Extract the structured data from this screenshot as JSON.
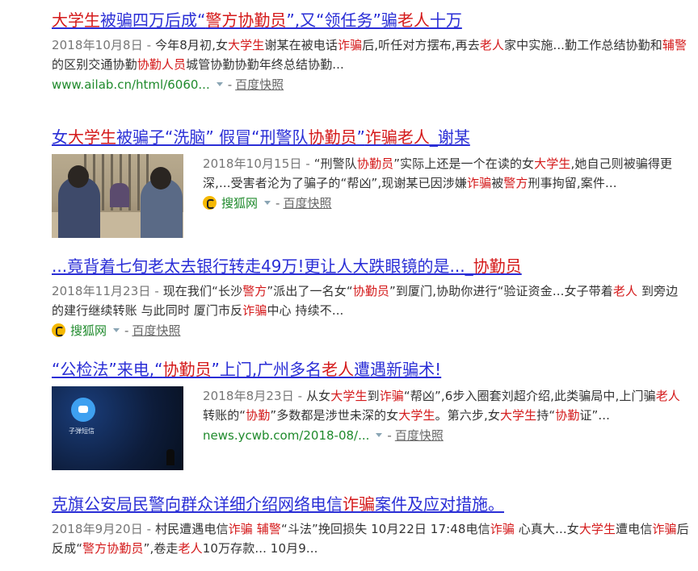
{
  "results": [
    {
      "title": [
        {
          "t": "大学生",
          "h": true
        },
        {
          "t": "被骗四万后成“",
          "h": false
        },
        {
          "t": "警方协勤员",
          "h": true
        },
        {
          "t": "”,又“领任务”骗",
          "h": false
        },
        {
          "t": "老人",
          "h": true
        },
        {
          "t": "十万",
          "h": false
        }
      ],
      "abstract": [
        {
          "t": "2018年10月8日 - ",
          "c": "date"
        },
        {
          "t": "今年8月初,女",
          "c": ""
        },
        {
          "t": "大学生",
          "c": "hl"
        },
        {
          "t": "谢某在被电话",
          "c": ""
        },
        {
          "t": "诈骗",
          "c": "hl"
        },
        {
          "t": "后,听任对方摆布,再去",
          "c": ""
        },
        {
          "t": "老人",
          "c": "hl"
        },
        {
          "t": "家中实施...勤工作总结协勤和",
          "c": ""
        },
        {
          "t": "辅警",
          "c": "hl"
        },
        {
          "t": "的区别交通协勤",
          "c": ""
        },
        {
          "t": "协勤人员",
          "c": "hl"
        },
        {
          "t": "城管协勤协勤年终总结协勤...",
          "c": ""
        }
      ],
      "source": {
        "url": "www.ailab.cn/html/6060...",
        "cache": "百度快照"
      }
    },
    {
      "title": [
        {
          "t": "女",
          "h": false
        },
        {
          "t": "大学生",
          "h": true
        },
        {
          "t": "被骗子“洗脑” 假冒“刑警队",
          "h": false
        },
        {
          "t": "协勤员",
          "h": true
        },
        {
          "t": "”",
          "h": false
        },
        {
          "t": "诈骗老人",
          "h": true
        },
        {
          "t": "_谢某",
          "h": false
        }
      ],
      "abstract": [
        {
          "t": "2018年10月15日 - ",
          "c": "date"
        },
        {
          "t": "“刑警队",
          "c": ""
        },
        {
          "t": "协勤员",
          "c": "hl"
        },
        {
          "t": "”实际上还是一个在读的女",
          "c": ""
        },
        {
          "t": "大学生",
          "c": "hl"
        },
        {
          "t": ",她自己则被骗得更深,...受害者沦为了骗子的“帮凶”,现谢某已因涉嫌",
          "c": ""
        },
        {
          "t": "诈骗",
          "c": "hl"
        },
        {
          "t": "被",
          "c": ""
        },
        {
          "t": "警方",
          "c": "hl"
        },
        {
          "t": "刑事拘留,案件...",
          "c": ""
        }
      ],
      "source": {
        "name": "搜狐网",
        "cache": "百度快照"
      }
    },
    {
      "title": [
        {
          "t": "...竟背着七旬老太去银行转走49万!更让人大跌眼镜的是..._",
          "h": false
        },
        {
          "t": "协勤员",
          "h": true
        }
      ],
      "abstract": [
        {
          "t": "2018年11月23日 - ",
          "c": "date"
        },
        {
          "t": "现在我们“长沙",
          "c": ""
        },
        {
          "t": "警方",
          "c": "hl"
        },
        {
          "t": "”派出了一名女“",
          "c": ""
        },
        {
          "t": "协勤员",
          "c": "hl"
        },
        {
          "t": "”到厦门,协助你进行“验证资金...女子带着",
          "c": ""
        },
        {
          "t": "老人",
          "c": "hl"
        },
        {
          "t": " 到旁边的建行继续转账 与此同时 厦门市反",
          "c": ""
        },
        {
          "t": "诈骗",
          "c": "hl"
        },
        {
          "t": "中心 持续不...",
          "c": ""
        }
      ],
      "source": {
        "name": "搜狐网",
        "cache": "百度快照"
      }
    },
    {
      "title": [
        {
          "t": "“公检法”来电,“",
          "h": false
        },
        {
          "t": "协勤员",
          "h": true
        },
        {
          "t": "”上门,广州多名",
          "h": false
        },
        {
          "t": "老人",
          "h": true
        },
        {
          "t": "遭遇新骗术!",
          "h": false
        }
      ],
      "abstract": [
        {
          "t": "2018年8月23日 - ",
          "c": "date"
        },
        {
          "t": "从女",
          "c": ""
        },
        {
          "t": "大学生",
          "c": "hl"
        },
        {
          "t": "到",
          "c": ""
        },
        {
          "t": "诈骗",
          "c": "hl"
        },
        {
          "t": "“帮凶”,6步入圈套刘超介绍,此类骗局中,上门骗",
          "c": ""
        },
        {
          "t": "老人",
          "c": "hl"
        },
        {
          "t": "转账的“",
          "c": ""
        },
        {
          "t": "协勤",
          "c": "hl"
        },
        {
          "t": "”多数都是涉世未深的女",
          "c": ""
        },
        {
          "t": "大学生",
          "c": "hl"
        },
        {
          "t": "。第六步,女",
          "c": ""
        },
        {
          "t": "大学生",
          "c": "hl"
        },
        {
          "t": "持“",
          "c": ""
        },
        {
          "t": "协勤",
          "c": "hl"
        },
        {
          "t": "证”...",
          "c": ""
        }
      ],
      "thumb_text": "子弹短信",
      "source": {
        "url": "news.ycwb.com/2018-08/...",
        "cache": "百度快照"
      }
    },
    {
      "title": [
        {
          "t": "克旗公安局民警向群众详细介绍网络电信",
          "h": false
        },
        {
          "t": "诈骗",
          "h": true
        },
        {
          "t": "案件及应对措施。",
          "h": false
        }
      ],
      "abstract": [
        {
          "t": "2018年9月20日 - ",
          "c": "date"
        },
        {
          "t": "村民遭遇电信",
          "c": ""
        },
        {
          "t": "诈骗",
          "c": "hl"
        },
        {
          "t": " ",
          "c": ""
        },
        {
          "t": "辅警",
          "c": "hl"
        },
        {
          "t": "“斗法”挽回损失 10月22日 17:48电信",
          "c": ""
        },
        {
          "t": "诈骗",
          "c": "hl"
        },
        {
          "t": " 心真大...女",
          "c": ""
        },
        {
          "t": "大学生",
          "c": "hl"
        },
        {
          "t": "遭电信",
          "c": ""
        },
        {
          "t": "诈骗",
          "c": "hl"
        },
        {
          "t": "后反成“",
          "c": ""
        },
        {
          "t": "警方协勤员",
          "c": "hl"
        },
        {
          "t": "”,卷走",
          "c": ""
        },
        {
          "t": "老人",
          "c": "hl"
        },
        {
          "t": "10万存款... 10月9...",
          "c": ""
        }
      ]
    }
  ],
  "colors": {
    "title": "#2a2ed6",
    "highlight": "#d4191a",
    "url": "#1f8a2c",
    "date": "#767676"
  }
}
